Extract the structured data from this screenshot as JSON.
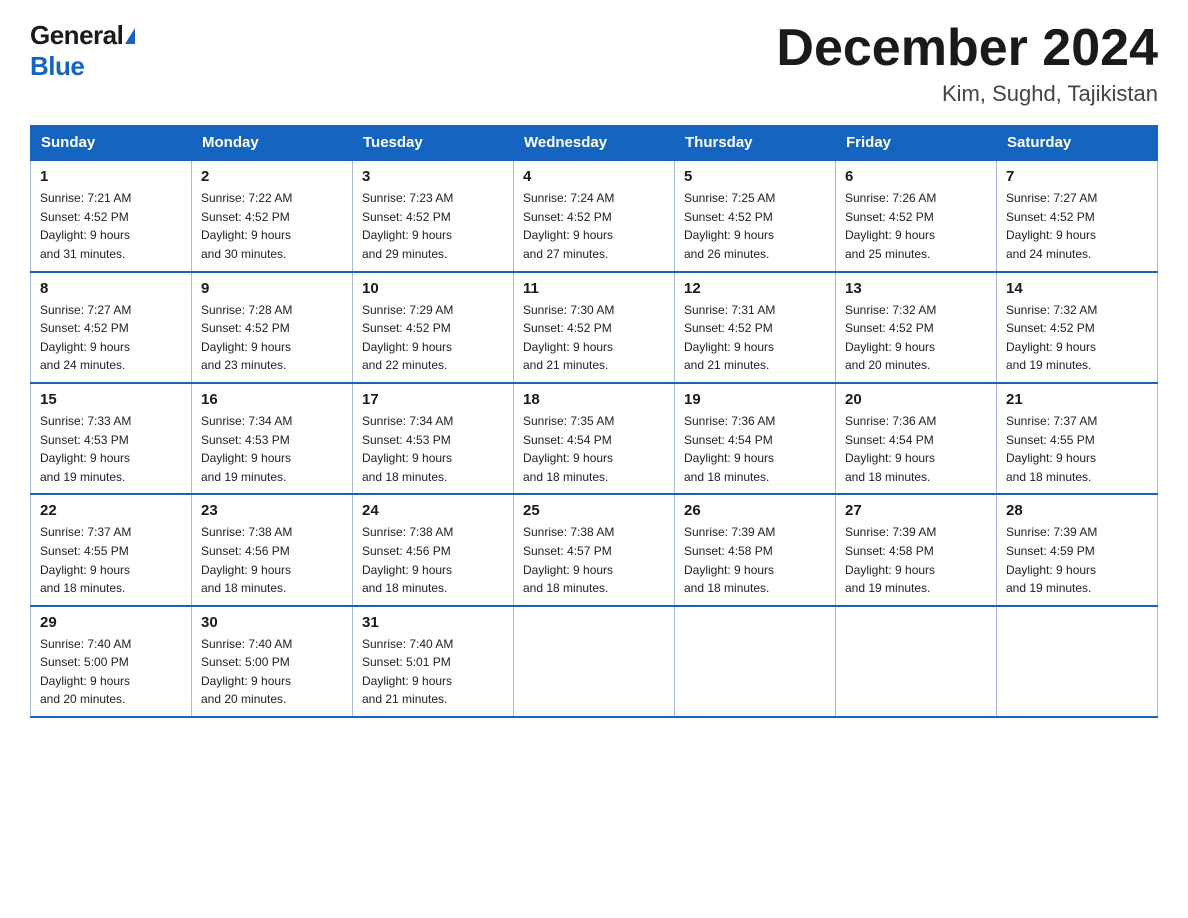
{
  "logo": {
    "general": "General",
    "blue": "Blue"
  },
  "title": "December 2024",
  "subtitle": "Kim, Sughd, Tajikistan",
  "days_of_week": [
    "Sunday",
    "Monday",
    "Tuesday",
    "Wednesday",
    "Thursday",
    "Friday",
    "Saturday"
  ],
  "weeks": [
    [
      {
        "num": "1",
        "sunrise": "7:21 AM",
        "sunset": "4:52 PM",
        "daylight": "9 hours and 31 minutes."
      },
      {
        "num": "2",
        "sunrise": "7:22 AM",
        "sunset": "4:52 PM",
        "daylight": "9 hours and 30 minutes."
      },
      {
        "num": "3",
        "sunrise": "7:23 AM",
        "sunset": "4:52 PM",
        "daylight": "9 hours and 29 minutes."
      },
      {
        "num": "4",
        "sunrise": "7:24 AM",
        "sunset": "4:52 PM",
        "daylight": "9 hours and 27 minutes."
      },
      {
        "num": "5",
        "sunrise": "7:25 AM",
        "sunset": "4:52 PM",
        "daylight": "9 hours and 26 minutes."
      },
      {
        "num": "6",
        "sunrise": "7:26 AM",
        "sunset": "4:52 PM",
        "daylight": "9 hours and 25 minutes."
      },
      {
        "num": "7",
        "sunrise": "7:27 AM",
        "sunset": "4:52 PM",
        "daylight": "9 hours and 24 minutes."
      }
    ],
    [
      {
        "num": "8",
        "sunrise": "7:27 AM",
        "sunset": "4:52 PM",
        "daylight": "9 hours and 24 minutes."
      },
      {
        "num": "9",
        "sunrise": "7:28 AM",
        "sunset": "4:52 PM",
        "daylight": "9 hours and 23 minutes."
      },
      {
        "num": "10",
        "sunrise": "7:29 AM",
        "sunset": "4:52 PM",
        "daylight": "9 hours and 22 minutes."
      },
      {
        "num": "11",
        "sunrise": "7:30 AM",
        "sunset": "4:52 PM",
        "daylight": "9 hours and 21 minutes."
      },
      {
        "num": "12",
        "sunrise": "7:31 AM",
        "sunset": "4:52 PM",
        "daylight": "9 hours and 21 minutes."
      },
      {
        "num": "13",
        "sunrise": "7:32 AM",
        "sunset": "4:52 PM",
        "daylight": "9 hours and 20 minutes."
      },
      {
        "num": "14",
        "sunrise": "7:32 AM",
        "sunset": "4:52 PM",
        "daylight": "9 hours and 19 minutes."
      }
    ],
    [
      {
        "num": "15",
        "sunrise": "7:33 AM",
        "sunset": "4:53 PM",
        "daylight": "9 hours and 19 minutes."
      },
      {
        "num": "16",
        "sunrise": "7:34 AM",
        "sunset": "4:53 PM",
        "daylight": "9 hours and 19 minutes."
      },
      {
        "num": "17",
        "sunrise": "7:34 AM",
        "sunset": "4:53 PM",
        "daylight": "9 hours and 18 minutes."
      },
      {
        "num": "18",
        "sunrise": "7:35 AM",
        "sunset": "4:54 PM",
        "daylight": "9 hours and 18 minutes."
      },
      {
        "num": "19",
        "sunrise": "7:36 AM",
        "sunset": "4:54 PM",
        "daylight": "9 hours and 18 minutes."
      },
      {
        "num": "20",
        "sunrise": "7:36 AM",
        "sunset": "4:54 PM",
        "daylight": "9 hours and 18 minutes."
      },
      {
        "num": "21",
        "sunrise": "7:37 AM",
        "sunset": "4:55 PM",
        "daylight": "9 hours and 18 minutes."
      }
    ],
    [
      {
        "num": "22",
        "sunrise": "7:37 AM",
        "sunset": "4:55 PM",
        "daylight": "9 hours and 18 minutes."
      },
      {
        "num": "23",
        "sunrise": "7:38 AM",
        "sunset": "4:56 PM",
        "daylight": "9 hours and 18 minutes."
      },
      {
        "num": "24",
        "sunrise": "7:38 AM",
        "sunset": "4:56 PM",
        "daylight": "9 hours and 18 minutes."
      },
      {
        "num": "25",
        "sunrise": "7:38 AM",
        "sunset": "4:57 PM",
        "daylight": "9 hours and 18 minutes."
      },
      {
        "num": "26",
        "sunrise": "7:39 AM",
        "sunset": "4:58 PM",
        "daylight": "9 hours and 18 minutes."
      },
      {
        "num": "27",
        "sunrise": "7:39 AM",
        "sunset": "4:58 PM",
        "daylight": "9 hours and 19 minutes."
      },
      {
        "num": "28",
        "sunrise": "7:39 AM",
        "sunset": "4:59 PM",
        "daylight": "9 hours and 19 minutes."
      }
    ],
    [
      {
        "num": "29",
        "sunrise": "7:40 AM",
        "sunset": "5:00 PM",
        "daylight": "9 hours and 20 minutes."
      },
      {
        "num": "30",
        "sunrise": "7:40 AM",
        "sunset": "5:00 PM",
        "daylight": "9 hours and 20 minutes."
      },
      {
        "num": "31",
        "sunrise": "7:40 AM",
        "sunset": "5:01 PM",
        "daylight": "9 hours and 21 minutes."
      },
      null,
      null,
      null,
      null
    ]
  ],
  "labels": {
    "sunrise": "Sunrise:",
    "sunset": "Sunset:",
    "daylight": "Daylight:"
  }
}
